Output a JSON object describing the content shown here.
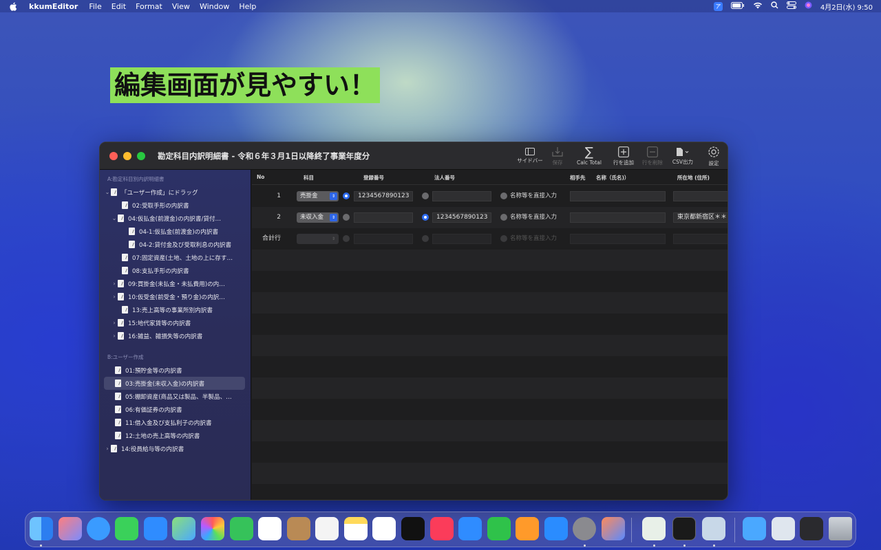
{
  "menubar": {
    "app_name": "kkumEditor",
    "items": [
      "File",
      "Edit",
      "Format",
      "View",
      "Window",
      "Help"
    ],
    "ime": "ア",
    "clock": "4月2日(水)  9:50"
  },
  "headline": "編集画面が見やすい！",
  "window": {
    "title": "勘定科目内訳明細書 - 令和６年３月1日以降終了事業年度分",
    "toolbar": {
      "sidebar": "サイドバー",
      "save": "保存",
      "calc_total": "Calc Total",
      "add_row": "行を追加",
      "delete_row": "行を削除",
      "csv_export": "CSV出力",
      "settings": "設定"
    }
  },
  "sidebar": {
    "section_a": "A:勘定科目別内訳明細書",
    "items_a": [
      "「ユーザー作成」にドラッグ",
      "02:受取手形の内訳書",
      "04:仮払金(前渡金)の内訳書/貸付…",
      "04-1:仮払金(前渡金)の内訳書",
      "04-2:貸付金及び受取利息の内訳書",
      "07:固定資産(土地、土地の上に存す…",
      "08:支払手形の内訳書",
      "09:買掛金(未払金・未払費用)の内…",
      "10:仮受金(前受金・預り金)の内訳…",
      "13:売上高等の事業所別内訳書",
      "15:地代家賃等の内訳書",
      "16:雑益、雑損失等の内訳書"
    ],
    "section_b": "B:ユーザー作成",
    "items_b": [
      "01:預貯金等の内訳書",
      "03:売掛金(未収入金)の内訳書",
      "05:棚卸資産(商品又は製品、半製品、…",
      "06:有価証券の内訳書",
      "11:借入金及び支払利子の内訳書",
      "12:土地の売上高等の内訳書",
      "14:役員給与等の内訳書"
    ]
  },
  "table": {
    "headers": {
      "no": "No",
      "account": "科目",
      "reg_no": "登録番号",
      "corp_no": "法人番号",
      "partner": "相手先",
      "name": "名称（氏名)）",
      "address": "所在地 (住所)"
    },
    "rows": [
      {
        "no": "1",
        "account": "売掛金",
        "reg_no": "1234567890123",
        "corp_no": "",
        "direct_label": "名称等を直接入力",
        "name": "",
        "address": ""
      },
      {
        "no": "2",
        "account": "未収入金",
        "reg_no": "",
        "corp_no": "1234567890123",
        "direct_label": "名称等を直接入力",
        "name": "",
        "address": "東京都新宿区＊＊＊"
      },
      {
        "no": "合計行",
        "account": "",
        "reg_no": "",
        "corp_no": "",
        "direct_label": "名称等を直接入力",
        "name": "",
        "address": ""
      }
    ]
  },
  "colors": {
    "accent_blue": "#2d6bf0",
    "headline_bg": "#8ee05a",
    "sidebar_bg": "#2c3166"
  }
}
